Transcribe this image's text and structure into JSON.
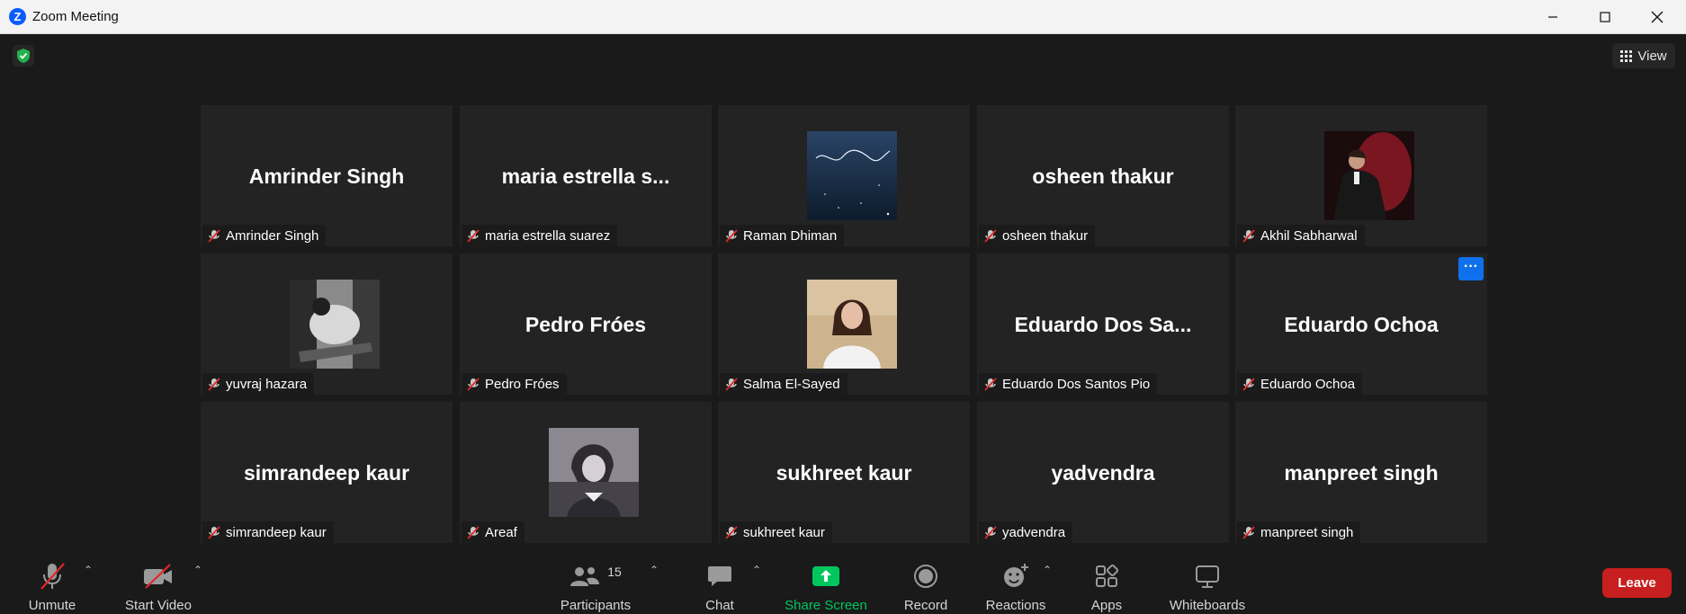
{
  "window": {
    "title": "Zoom Meeting",
    "logo_letter": "Z"
  },
  "top": {
    "view_label": "View"
  },
  "participants": [
    {
      "display": "Amrinder Singh",
      "label": "Amrinder Singh",
      "photo": ""
    },
    {
      "display": "maria estrella s...",
      "label": "maria estrella suarez",
      "photo": ""
    },
    {
      "display": "",
      "label": "Raman Dhiman",
      "photo": "night-sky"
    },
    {
      "display": "osheen thakur",
      "label": "osheen thakur",
      "photo": ""
    },
    {
      "display": "",
      "label": "Akhil Sabharwal",
      "photo": "man-red-chair"
    },
    {
      "display": "",
      "label": "yuvraj hazara",
      "photo": "bw-photo"
    },
    {
      "display": "Pedro Fróes",
      "label": "Pedro Fróes",
      "photo": ""
    },
    {
      "display": "",
      "label": "Salma El-Sayed",
      "photo": "woman-portrait"
    },
    {
      "display": "Eduardo Dos Sa...",
      "label": "Eduardo Dos Santos Pio",
      "photo": ""
    },
    {
      "display": "Eduardo Ochoa",
      "label": "Eduardo Ochoa",
      "photo": ""
    },
    {
      "display": "simrandeep kaur",
      "label": "simrandeep kaur",
      "photo": ""
    },
    {
      "display": "",
      "label": "Areaf",
      "photo": "anime-character"
    },
    {
      "display": "sukhreet kaur",
      "label": "sukhreet kaur",
      "photo": ""
    },
    {
      "display": "yadvendra",
      "label": "yadvendra",
      "photo": ""
    },
    {
      "display": "manpreet singh",
      "label": "manpreet singh",
      "photo": ""
    }
  ],
  "more_button_label": "···",
  "toolbar": {
    "unmute": "Unmute",
    "start_video": "Start Video",
    "participants": "Participants",
    "participants_count": "15",
    "chat": "Chat",
    "share_screen": "Share Screen",
    "record": "Record",
    "reactions": "Reactions",
    "apps": "Apps",
    "whiteboards": "Whiteboards",
    "leave": "Leave"
  },
  "colors": {
    "share_green": "#00c65e",
    "leave_red": "#c71f1f",
    "accent_blue": "#0e71eb",
    "mute_red": "#e02828"
  }
}
